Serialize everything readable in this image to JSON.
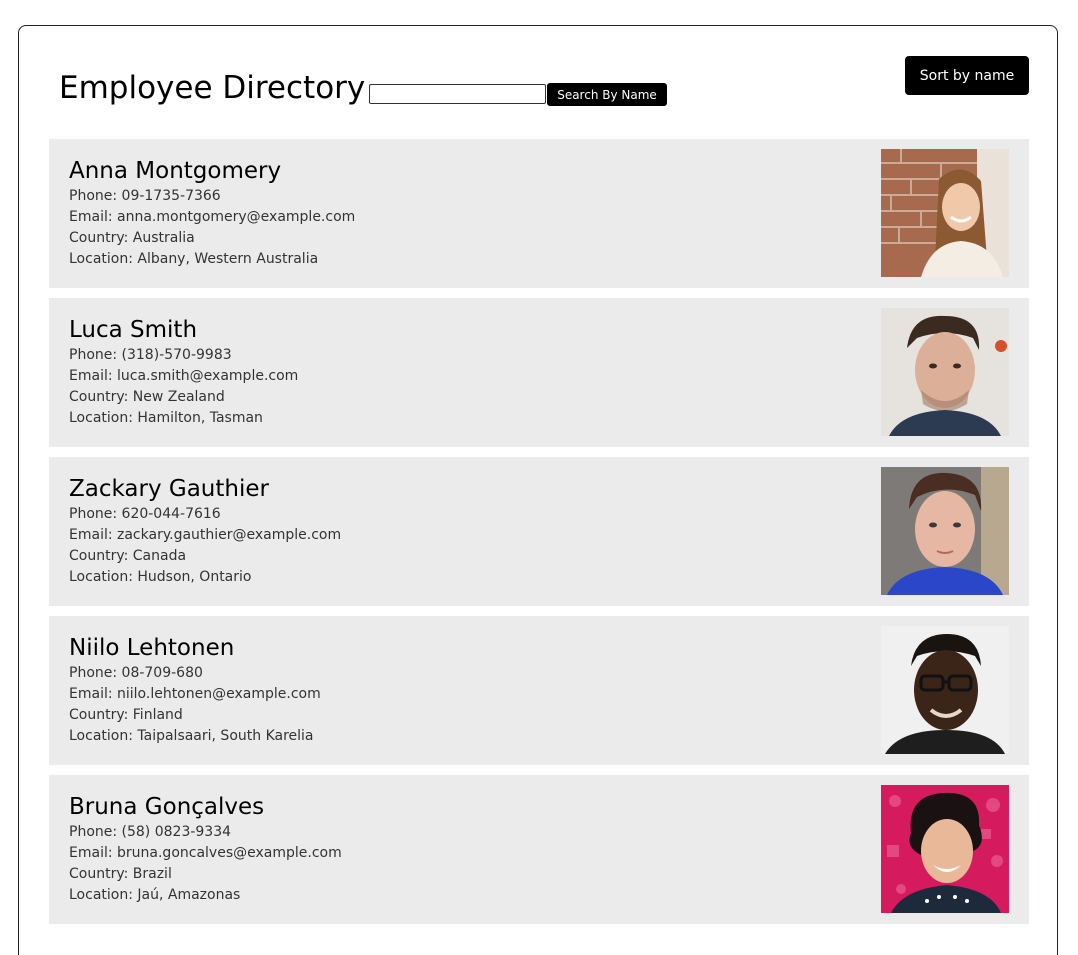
{
  "header": {
    "title": "Employee Directory",
    "search_placeholder": "",
    "search_value": "",
    "search_button_label": "Search By Name",
    "sort_button_label": "Sort by name"
  },
  "employees": [
    {
      "name": "Anna Montgomery",
      "phone": "Phone: 09-1735-7366",
      "email": "Email: anna.montgomery@example.com",
      "country": "Country: Australia",
      "location": "Location: Albany, Western Australia"
    },
    {
      "name": "Luca Smith",
      "phone": "Phone: (318)-570-9983",
      "email": "Email: luca.smith@example.com",
      "country": "Country: New Zealand",
      "location": "Location: Hamilton, Tasman"
    },
    {
      "name": "Zackary Gauthier",
      "phone": "Phone: 620-044-7616",
      "email": "Email: zackary.gauthier@example.com",
      "country": "Country: Canada",
      "location": "Location: Hudson, Ontario"
    },
    {
      "name": "Niilo Lehtonen",
      "phone": "Phone: 08-709-680",
      "email": "Email: niilo.lehtonen@example.com",
      "country": "Country: Finland",
      "location": "Location: Taipalsaari, South Karelia"
    },
    {
      "name": "Bruna Gonçalves",
      "phone": "Phone: (58) 0823-9334",
      "email": "Email: bruna.goncalves@example.com",
      "country": "Country: Brazil",
      "location": "Location: Jaú, Amazonas"
    }
  ],
  "colors": {
    "card_background": "#ebebeb",
    "button_background": "#000000",
    "button_text": "#ffffff"
  }
}
